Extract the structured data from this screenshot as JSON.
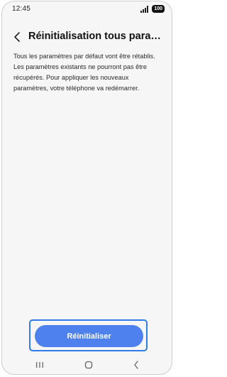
{
  "status_bar": {
    "time": "12:45",
    "battery": "100"
  },
  "header": {
    "title": "Réinitialisation tous paramèt..."
  },
  "body": {
    "description": "Tous les paramètres par défaut vont être rétablis. Les paramètres existants ne pourront pas être récupérés. Pour appliquer les nouveaux paramètres, votre téléphone va redémarrer."
  },
  "actions": {
    "reset_label": "Réinitialiser"
  },
  "colors": {
    "accent": "#4f81ee",
    "highlight": "#2f7be8",
    "background": "#f6f6f6"
  },
  "icons": {
    "back": "chevron-left-icon",
    "nav_recents": "recents-icon",
    "nav_home": "home-icon",
    "nav_back": "back-icon"
  }
}
